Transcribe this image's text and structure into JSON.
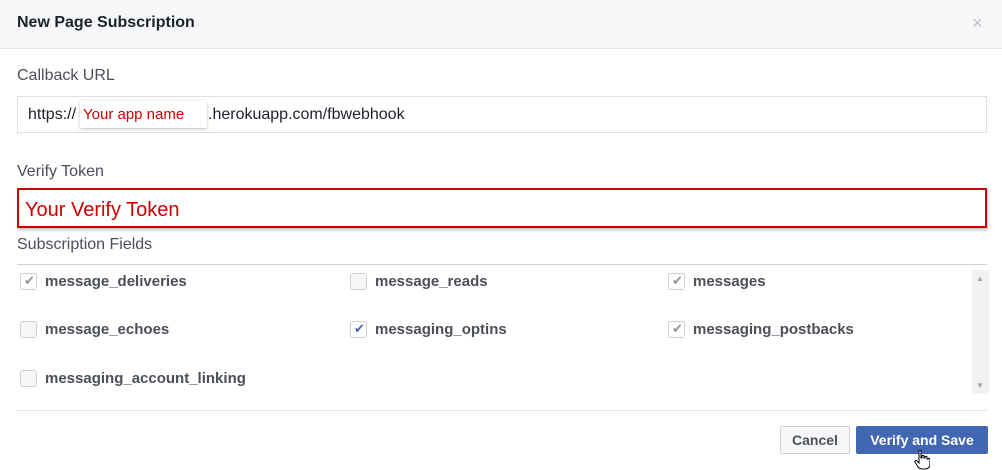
{
  "dialog": {
    "title": "New Page Subscription",
    "close_glyph": "×"
  },
  "callback": {
    "label": "Callback URL",
    "prefix": "https://",
    "app_name": "Your app name",
    "suffix": ".herokuapp.com/fbwebhook"
  },
  "verify": {
    "label": "Verify Token",
    "value": "Your Verify Token"
  },
  "subscription": {
    "label": "Subscription Fields",
    "fields": [
      {
        "name": "message_deliveries",
        "checked": true
      },
      {
        "name": "message_reads",
        "checked": false
      },
      {
        "name": "messages",
        "checked": true
      },
      {
        "name": "message_echoes",
        "checked": false
      },
      {
        "name": "messaging_optins",
        "checked": true
      },
      {
        "name": "messaging_postbacks",
        "checked": true
      },
      {
        "name": "messaging_account_linking",
        "checked": false
      }
    ]
  },
  "buttons": {
    "cancel": "Cancel",
    "save": "Verify and Save"
  },
  "icons": {
    "check": "✔",
    "scroll_up": "▲",
    "scroll_down": "▼"
  },
  "colors": {
    "accent": "#4267b2",
    "annotation_red": "#cc0000"
  }
}
